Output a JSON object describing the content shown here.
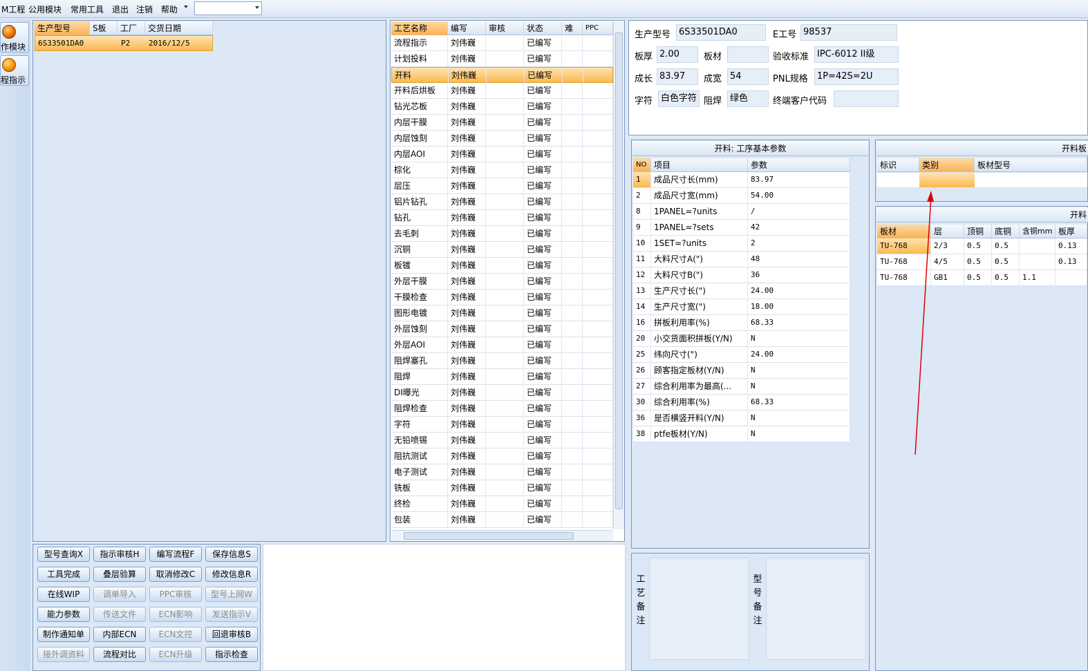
{
  "menubar": {
    "items": [
      "M工程",
      "公用模块",
      "常用工具",
      "退出",
      "注销",
      "帮助"
    ],
    "dropdown_value": ""
  },
  "leftnav": {
    "items": [
      {
        "label": "作模块",
        "icon": "fire-icon"
      },
      {
        "label": "程指示",
        "icon": "pause-icon"
      }
    ]
  },
  "order_grid": {
    "headers": [
      "生产型号",
      "S板",
      "工厂",
      "交货日期"
    ],
    "rows": [
      [
        "6S33501DA0",
        "",
        "P2",
        "2016/12/5"
      ]
    ]
  },
  "process_grid": {
    "headers": [
      "工艺名称",
      "编写",
      "审核",
      "状态",
      "难",
      "PPC"
    ],
    "rows": [
      [
        "流程指示",
        "刘伟巍",
        "",
        "已编写"
      ],
      [
        "计划投料",
        "刘伟巍",
        "",
        "已编写"
      ],
      [
        "开料",
        "刘伟巍",
        "",
        "已编写"
      ],
      [
        "开料后烘板",
        "刘伟巍",
        "",
        "已编写"
      ],
      [
        "钻光芯板",
        "刘伟巍",
        "",
        "已编写"
      ],
      [
        "内层干膜",
        "刘伟巍",
        "",
        "已编写"
      ],
      [
        "内层蚀刻",
        "刘伟巍",
        "",
        "已编写"
      ],
      [
        "内层AOI",
        "刘伟巍",
        "",
        "已编写"
      ],
      [
        "棕化",
        "刘伟巍",
        "",
        "已编写"
      ],
      [
        "层压",
        "刘伟巍",
        "",
        "已编写"
      ],
      [
        "铝片钻孔",
        "刘伟巍",
        "",
        "已编写"
      ],
      [
        "钻孔",
        "刘伟巍",
        "",
        "已编写"
      ],
      [
        "去毛刺",
        "刘伟巍",
        "",
        "已编写"
      ],
      [
        "沉铜",
        "刘伟巍",
        "",
        "已编写"
      ],
      [
        "板镀",
        "刘伟巍",
        "",
        "已编写"
      ],
      [
        "外层干膜",
        "刘伟巍",
        "",
        "已编写"
      ],
      [
        "干膜检查",
        "刘伟巍",
        "",
        "已编写"
      ],
      [
        "图形电镀",
        "刘伟巍",
        "",
        "已编写"
      ],
      [
        "外层蚀刻",
        "刘伟巍",
        "",
        "已编写"
      ],
      [
        "外层AOI",
        "刘伟巍",
        "",
        "已编写"
      ],
      [
        "阻焊塞孔",
        "刘伟巍",
        "",
        "已编写"
      ],
      [
        "阻焊",
        "刘伟巍",
        "",
        "已编写"
      ],
      [
        "DI曝光",
        "刘伟巍",
        "",
        "已编写"
      ],
      [
        "阻焊检查",
        "刘伟巍",
        "",
        "已编写"
      ],
      [
        "字符",
        "刘伟巍",
        "",
        "已编写"
      ],
      [
        "无铅喷锡",
        "刘伟巍",
        "",
        "已编写"
      ],
      [
        "阻抗测试",
        "刘伟巍",
        "",
        "已编写"
      ],
      [
        "电子测试",
        "刘伟巍",
        "",
        "已编写"
      ],
      [
        "铣板",
        "刘伟巍",
        "",
        "已编写"
      ],
      [
        "终检",
        "刘伟巍",
        "",
        "已编写"
      ],
      [
        "包装",
        "刘伟巍",
        "",
        "已编写"
      ]
    ]
  },
  "buttons": [
    [
      "型号查询X",
      "指示审核H",
      "编写流程F",
      "保存信息S"
    ],
    [
      "工具完成",
      "叠层验算",
      "取消修改C",
      "修改信息R"
    ],
    [
      "在线WIP",
      "调单导入",
      "PPC审核",
      "型号上网W"
    ],
    [
      "能力参数",
      "传送文件",
      "ECN影响",
      "发送指示V"
    ],
    [
      "制作通知单",
      "内部ECN",
      "ECN文控",
      "回退审核B"
    ],
    [
      "接外调资料",
      "流程对比",
      "ECN升级",
      "指示检查"
    ]
  ],
  "info": {
    "model_label": "生产型号",
    "model": "6S33501DA0",
    "eng_label": "E工号",
    "eng": "98537",
    "thick_label": "板厚",
    "thick": "2.00",
    "material_label": "板材",
    "material": "",
    "std_label": "验收标准",
    "std": "IPC-6012 II级",
    "len_label": "成长",
    "len": "83.97",
    "wid_label": "成宽",
    "wid": "54",
    "pnl_label": "PNL规格",
    "pnl": "1P=42S=2U",
    "char_label": "字符",
    "char": "白色字符",
    "mask_label": "阻焊",
    "mask": "绿色",
    "cust_label": "终端客户代码",
    "cust": ""
  },
  "params": {
    "title": "开料: 工序基本参数",
    "headers": [
      "NO",
      "项目",
      "参数"
    ],
    "rows": [
      [
        "1",
        "成品尺寸长(mm)",
        "83.97"
      ],
      [
        "2",
        "成品尺寸宽(mm)",
        "54.00"
      ],
      [
        "8",
        "1PANEL=?units",
        "/"
      ],
      [
        "9",
        "1PANEL=?sets",
        "42"
      ],
      [
        "10",
        "1SET=?units",
        "2"
      ],
      [
        "11",
        "大料尺寸A(\")",
        "48"
      ],
      [
        "12",
        "大料尺寸B(\")",
        "36"
      ],
      [
        "13",
        "生产尺寸长(\")",
        "24.00"
      ],
      [
        "14",
        "生产尺寸宽(\")",
        "18.00"
      ],
      [
        "16",
        "拼板利用率(%)",
        "68.33"
      ],
      [
        "20",
        "小交货面积拼板(Y/N)",
        "N"
      ],
      [
        "25",
        "纬向尺寸(\")",
        "24.00"
      ],
      [
        "26",
        "顾客指定板材(Y/N)",
        "N"
      ],
      [
        "27",
        "综合利用率为最高(...",
        "N"
      ],
      [
        "30",
        "综合利用率(%)",
        "68.33"
      ],
      [
        "36",
        "是否横竖开料(Y/N)",
        "N"
      ],
      [
        "38",
        "ptfe板材(Y/N)",
        "N"
      ]
    ]
  },
  "board_type": {
    "title": "开料板",
    "headers": [
      "标识",
      "类别",
      "板材型号"
    ]
  },
  "board_layers": {
    "title": "开料",
    "headers": [
      "板材",
      "层",
      "顶铜",
      "底铜",
      "含铜mm",
      "板厚"
    ],
    "rows": [
      [
        "TU-768",
        "2/3",
        "0.5",
        "0.5",
        "",
        "0.13"
      ],
      [
        "TU-768",
        "4/5",
        "0.5",
        "0.5",
        "",
        "0.13"
      ],
      [
        "TU-768",
        "GB1",
        "0.5",
        "0.5",
        "1.1",
        ""
      ]
    ]
  },
  "memo": {
    "process_label": "工艺备注",
    "model_label": "型号备注"
  }
}
